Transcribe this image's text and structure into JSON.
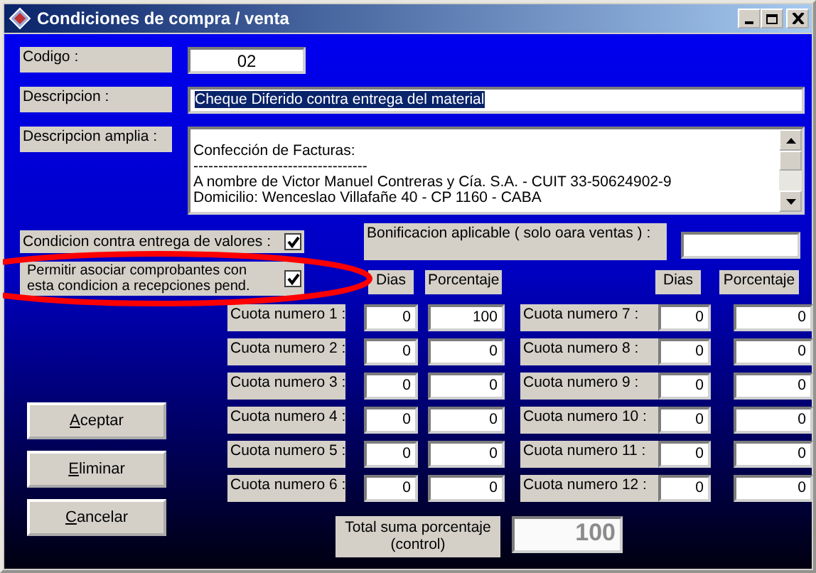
{
  "window": {
    "title": "Condiciones de compra / venta"
  },
  "codigo": {
    "label": "Codigo :",
    "value": "02"
  },
  "descripcion": {
    "label": "Descripcion :",
    "value": "Cheque Diferido contra entrega del material",
    "text_selected": true
  },
  "descripcion_amplia": {
    "label": "Descripcion amplia :",
    "lines": [
      "Confección de Facturas:",
      "-----------------------------------",
      "A nombre de Victor Manuel Contreras y Cía. S.A. - CUIT 33-50624902-9",
      "Domicilio: Wenceslao Villafañe 40 - CP 1160 - CABA"
    ]
  },
  "checkboxes": [
    {
      "label": "Condicion contra entrega de valores :",
      "checked": true
    },
    {
      "label": "Permitir asociar comprobantes con esta condicion a recepciones pend.",
      "checked": true
    }
  ],
  "bonificacion": {
    "label": "Bonificacion aplicable ( solo oara ventas ) :"
  },
  "headers": [
    "Dias",
    "Porcentaje",
    "Dias",
    "Porcentaje"
  ],
  "cuotas": [
    {
      "label": "Cuota numero 1 :",
      "dias": "0",
      "porcentaje": "100"
    },
    {
      "label": "Cuota numero 2 :",
      "dias": "0",
      "porcentaje": "0"
    },
    {
      "label": "Cuota numero 3 :",
      "dias": "0",
      "porcentaje": "0"
    },
    {
      "label": "Cuota numero 4 :",
      "dias": "0",
      "porcentaje": "0"
    },
    {
      "label": "Cuota numero 5 :",
      "dias": "0",
      "porcentaje": "0"
    },
    {
      "label": "Cuota numero 6 :",
      "dias": "0",
      "porcentaje": "0"
    },
    {
      "label": "Cuota numero 7 :",
      "dias": "0",
      "porcentaje": "0"
    },
    {
      "label": "Cuota numero 8 :",
      "dias": "0",
      "porcentaje": "0"
    },
    {
      "label": "Cuota numero 9 :",
      "dias": "0",
      "porcentaje": "0"
    },
    {
      "label": "Cuota numero 10 :",
      "dias": "0",
      "porcentaje": "0"
    },
    {
      "label": "Cuota numero 11 :",
      "dias": "0",
      "porcentaje": "0"
    },
    {
      "label": "Cuota numero 12 :",
      "dias": "0",
      "porcentaje": "0"
    }
  ],
  "buttons": [
    {
      "label": "Aceptar"
    },
    {
      "label": "Eliminar"
    },
    {
      "label": "Cancelar"
    }
  ],
  "total": {
    "label": "Total suma porcentaje (control)",
    "value": "100",
    "disabled": true
  }
}
